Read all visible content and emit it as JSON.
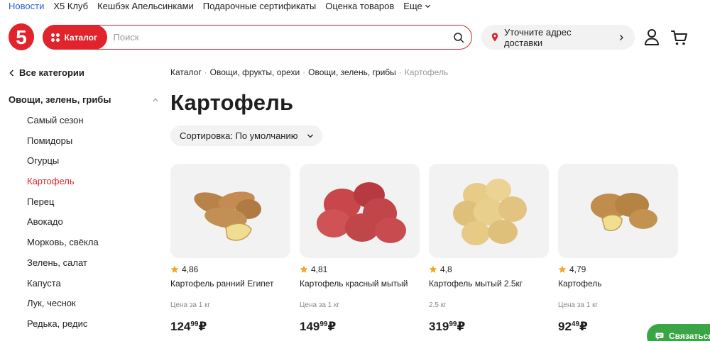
{
  "top_links": [
    "Новости",
    "X5 Клуб",
    "Кешбэк Апельсинками",
    "Подарочные сертификаты",
    "Оценка товаров"
  ],
  "top_more": "Еще",
  "header": {
    "logo_text": "5",
    "catalog_label": "Каталог",
    "search_placeholder": "Поиск",
    "search_value": "",
    "address_label": "Уточните адрес доставки"
  },
  "sidebar": {
    "all_categories": "Все категории",
    "group": "Овощи, зелень, грибы",
    "items": [
      {
        "label": "Самый сезон"
      },
      {
        "label": "Помидоры"
      },
      {
        "label": "Огурцы"
      },
      {
        "label": "Картофель",
        "active": true
      },
      {
        "label": "Перец"
      },
      {
        "label": "Авокадо"
      },
      {
        "label": "Морковь, свёкла"
      },
      {
        "label": "Зелень, салат"
      },
      {
        "label": "Капуста"
      },
      {
        "label": "Лук, чеснок"
      },
      {
        "label": "Редька, редис"
      }
    ]
  },
  "breadcrumb": [
    "Каталог",
    "Овощи, фрукты, орехи",
    "Овощи, зелень, грибы",
    "Картофель"
  ],
  "page_title": "Картофель",
  "sort_label": "Сортировка: По умолчанию",
  "products": [
    {
      "rating": "4,86",
      "name": "Картофель ранний Египет",
      "unit": "Цена за 1 кг",
      "price_rub": "124",
      "price_kop": "99",
      "currency": "₽"
    },
    {
      "rating": "4,81",
      "name": "Картофель красный мытый",
      "unit": "Цена за 1 кг",
      "price_rub": "149",
      "price_kop": "99",
      "currency": "₽"
    },
    {
      "rating": "4,8",
      "name": "Картофель мытый 2.5кг",
      "unit": "2.5 кг",
      "price_rub": "319",
      "price_kop": "99",
      "currency": "₽"
    },
    {
      "rating": "4,79",
      "name": "Картофель",
      "unit": "Цена за 1 кг",
      "price_rub": "92",
      "price_kop": "49",
      "currency": "₽"
    }
  ],
  "chat_label": "Связаться",
  "colors": {
    "brand_red": "#e1232b",
    "link_blue": "#2561d6",
    "star": "#f5a623",
    "chat_green": "#3aa545"
  }
}
